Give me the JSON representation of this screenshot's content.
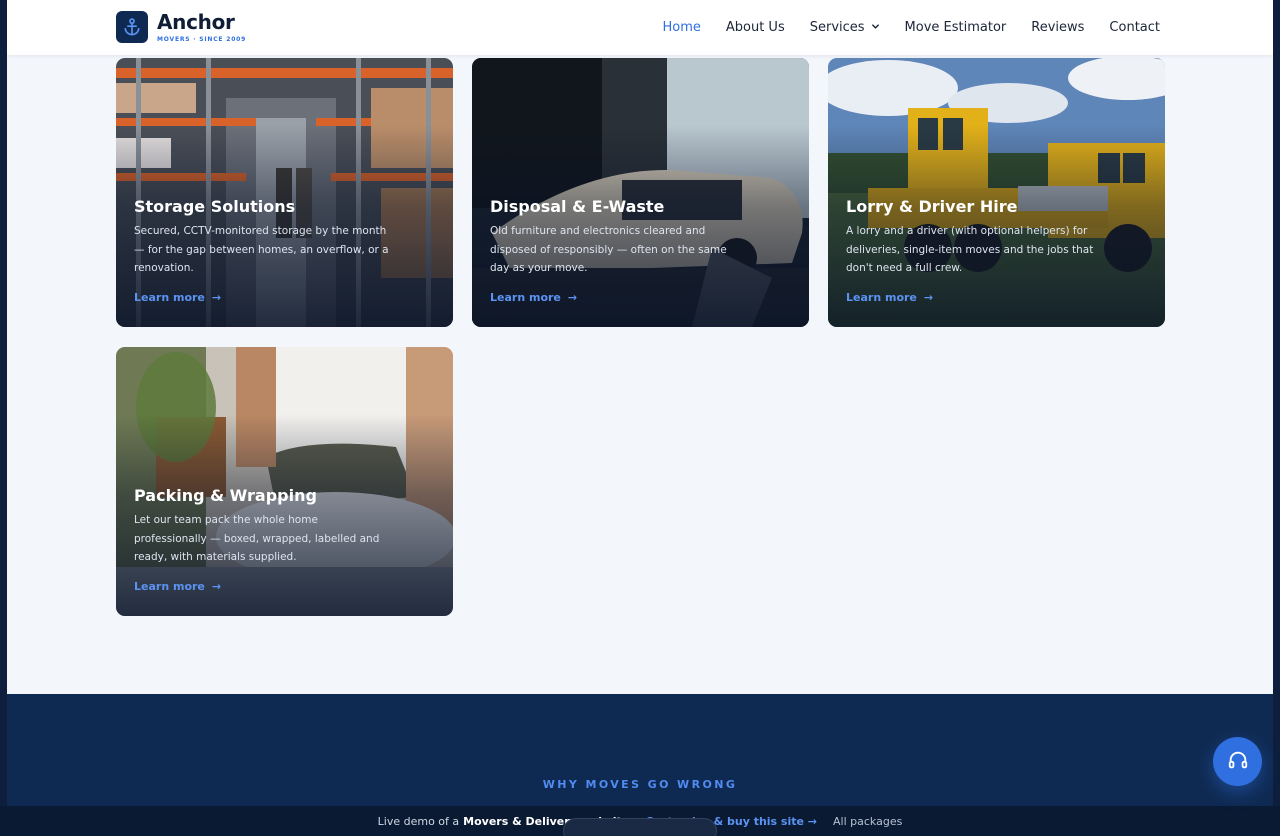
{
  "brand": {
    "name": "Anchor",
    "tagline": "MOVERS · SINCE 2009"
  },
  "nav": {
    "items": [
      {
        "label": "Home",
        "active": true
      },
      {
        "label": "About Us"
      },
      {
        "label": "Services",
        "dropdown": true
      },
      {
        "label": "Move Estimator"
      },
      {
        "label": "Reviews"
      },
      {
        "label": "Contact"
      }
    ]
  },
  "services": [
    {
      "title": "Storage Solutions",
      "description": "Secured, CCTV-monitored storage by the month — for the gap between homes, an overflow, or a renovation.",
      "link": "Learn more"
    },
    {
      "title": "Disposal & E-Waste",
      "description": "Old furniture and electronics cleared and disposed of responsibly — often on the same day as your move.",
      "link": "Learn more"
    },
    {
      "title": "Lorry & Driver Hire",
      "description": "A lorry and a driver (with optional helpers) for deliveries, single-item moves and the jobs that don't need a full crew.",
      "link": "Learn more"
    },
    {
      "title": "Packing & Wrapping",
      "description": "Let our team pack the whole home professionally — boxed, wrapped, labelled and ready, with materials supplied.",
      "link": "Learn more"
    }
  ],
  "problems_section": {
    "eyebrow": "WHY MOVES GO WRONG"
  },
  "demo_bar": {
    "prefix": "Live demo of a",
    "product": "Movers & Delivery website",
    "cta": "Customise & buy this site →",
    "all": "All packages"
  },
  "colors": {
    "accent": "#2f6fe0",
    "navy": "#0f2a52",
    "link": "#5b93f2"
  },
  "icons": {
    "logo": "anchor-icon",
    "dropdown": "chevron-down-icon",
    "arrow": "arrow-right-icon",
    "support": "headset-icon"
  }
}
